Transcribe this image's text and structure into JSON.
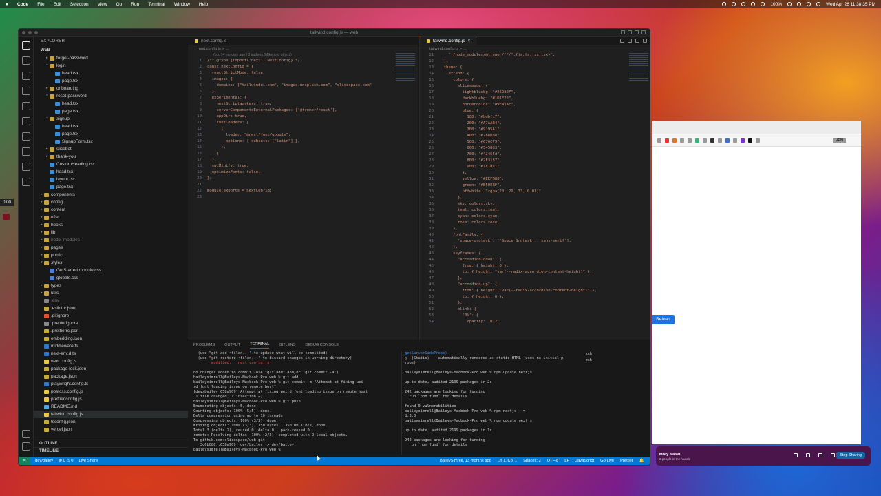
{
  "menubar": {
    "app": "Code",
    "items": [
      "File",
      "Edit",
      "Selection",
      "View",
      "Go",
      "Run",
      "Terminal",
      "Window",
      "Help"
    ],
    "battery": "100%",
    "datetime": "Wed Apr 26  11:38:35 PM"
  },
  "side_counter": "0:00",
  "window": {
    "title": "tailwind.config.js — web"
  },
  "explorer": {
    "header": "EXPLORER",
    "workspace": "WEB",
    "items": [
      {
        "label": "forgot-password",
        "indent": 1,
        "type": "folder",
        "open": false
      },
      {
        "label": "login",
        "indent": 1,
        "type": "folder",
        "open": true
      },
      {
        "label": "head.tsx",
        "indent": 2,
        "type": "tsx"
      },
      {
        "label": "page.tsx",
        "indent": 2,
        "type": "tsx"
      },
      {
        "label": "onboarding",
        "indent": 1,
        "type": "folder",
        "open": false
      },
      {
        "label": "reset-password",
        "indent": 1,
        "type": "folder",
        "open": true
      },
      {
        "label": "head.tsx",
        "indent": 2,
        "type": "tsx"
      },
      {
        "label": "page.tsx",
        "indent": 2,
        "type": "tsx"
      },
      {
        "label": "signup",
        "indent": 1,
        "type": "folder",
        "open": true
      },
      {
        "label": "head.tsx",
        "indent": 2,
        "type": "tsx"
      },
      {
        "label": "page.tsx",
        "indent": 2,
        "type": "tsx"
      },
      {
        "label": "SignupForm.tsx",
        "indent": 2,
        "type": "tsx"
      },
      {
        "label": "slicebot",
        "indent": 1,
        "type": "folder",
        "open": false
      },
      {
        "label": "thank-you",
        "indent": 1,
        "type": "folder",
        "open": false
      },
      {
        "label": "CustomHeading.tsx",
        "indent": 1,
        "type": "tsx"
      },
      {
        "label": "head.tsx",
        "indent": 1,
        "type": "tsx"
      },
      {
        "label": "layout.tsx",
        "indent": 1,
        "type": "tsx"
      },
      {
        "label": "page.tsx",
        "indent": 1,
        "type": "tsx"
      },
      {
        "label": "components",
        "indent": 0,
        "type": "folder",
        "open": false
      },
      {
        "label": "config",
        "indent": 0,
        "type": "folder",
        "open": false
      },
      {
        "label": "content",
        "indent": 0,
        "type": "folder",
        "open": false
      },
      {
        "label": "e2e",
        "indent": 0,
        "type": "folder",
        "open": false
      },
      {
        "label": "hooks",
        "indent": 0,
        "type": "folder",
        "open": false
      },
      {
        "label": "lib",
        "indent": 0,
        "type": "folder",
        "open": false
      },
      {
        "label": "node_modules",
        "indent": 0,
        "type": "folder",
        "open": false,
        "dim": true
      },
      {
        "label": "pages",
        "indent": 0,
        "type": "folder",
        "open": false
      },
      {
        "label": "public",
        "indent": 0,
        "type": "folder",
        "open": false
      },
      {
        "label": "styles",
        "indent": 0,
        "type": "folder",
        "open": true
      },
      {
        "label": "GetStarted.module.css",
        "indent": 1,
        "type": "css"
      },
      {
        "label": "globals.css",
        "indent": 1,
        "type": "css"
      },
      {
        "label": "types",
        "indent": 0,
        "type": "folder",
        "open": false
      },
      {
        "label": "utils",
        "indent": 0,
        "type": "folder",
        "open": false
      },
      {
        "label": ".env",
        "indent": 0,
        "type": "misc",
        "dim": true
      },
      {
        "label": ".eslintrc.json",
        "indent": 0,
        "type": "json"
      },
      {
        "label": ".gitignore",
        "indent": 0,
        "type": "git"
      },
      {
        "label": ".prettierignore",
        "indent": 0,
        "type": "misc"
      },
      {
        "label": ".prettierrc.json",
        "indent": 0,
        "type": "json"
      },
      {
        "label": "embedding.json",
        "indent": 0,
        "type": "json"
      },
      {
        "label": "middleware.ts",
        "indent": 0,
        "type": "ts"
      },
      {
        "label": "next-env.d.ts",
        "indent": 0,
        "type": "ts"
      },
      {
        "label": "next.config.js",
        "indent": 0,
        "type": "js"
      },
      {
        "label": "package-lock.json",
        "indent": 0,
        "type": "json"
      },
      {
        "label": "package.json",
        "indent": 0,
        "type": "json"
      },
      {
        "label": "playwright.config.ts",
        "indent": 0,
        "type": "ts"
      },
      {
        "label": "postcss.config.js",
        "indent": 0,
        "type": "js"
      },
      {
        "label": "prettier.config.js",
        "indent": 0,
        "type": "js"
      },
      {
        "label": "README.md",
        "indent": 0,
        "type": "md"
      },
      {
        "label": "tailwind.config.js",
        "indent": 0,
        "type": "js",
        "selected": true
      },
      {
        "label": "tsconfig.json",
        "indent": 0,
        "type": "json"
      },
      {
        "label": "vercel.json",
        "indent": 0,
        "type": "json"
      }
    ],
    "outline": "OUTLINE",
    "timeline": "TIMELINE"
  },
  "editor1": {
    "tab": "next.config.js",
    "breadcrumb": "next.config.js > ...",
    "codelens": "You, 14 minutes ago | 3 authors (Mike and others)",
    "lines": [
      {
        "n": "1",
        "t": "/** @type {import('next').NextConfig} */"
      },
      {
        "n": "2",
        "t": "const nextConfig = {"
      },
      {
        "n": "3",
        "t": "  reactStrictMode: false,"
      },
      {
        "n": "4",
        "t": "  images: {"
      },
      {
        "n": "5",
        "t": "    domains: [\"tailwindui.com\", \"images.unsplash.com\", \"slicespace.com\""
      },
      {
        "n": "6",
        "t": "  },"
      },
      {
        "n": "7",
        "t": "  experimental: {"
      },
      {
        "n": "8",
        "t": "    nextScriptWorkers: true,"
      },
      {
        "n": "9",
        "t": "    serverComponentsExternalPackages: ['@tremor/react'],"
      },
      {
        "n": "10",
        "t": "    appDir: true,"
      },
      {
        "n": "11",
        "t": "    fontLoaders: ["
      },
      {
        "n": "12",
        "t": "      {"
      },
      {
        "n": "13",
        "t": "        loader: \"@next/font/google\","
      },
      {
        "n": "14",
        "t": "        options: { subsets: [\"latin\"] },"
      },
      {
        "n": "15",
        "t": "      },"
      },
      {
        "n": "16",
        "t": "    ],"
      },
      {
        "n": "17",
        "t": "  },"
      },
      {
        "n": "18",
        "t": "  swcMinify: true,"
      },
      {
        "n": "19",
        "t": "  optimizeFonts: false,"
      },
      {
        "n": "20",
        "t": "};"
      },
      {
        "n": "21",
        "t": ""
      },
      {
        "n": "22",
        "t": "module.exports = nextConfig;"
      },
      {
        "n": "23",
        "t": ""
      }
    ]
  },
  "editor2": {
    "tab": "tailwind.config.js",
    "breadcrumb": "tailwind.config.js > ...",
    "lines": [
      {
        "n": "11",
        "t": "    \"./node_modules/@tremor/**/*.{js,ts,jsx,tsx}\","
      },
      {
        "n": "12",
        "t": "  ],"
      },
      {
        "n": "13",
        "t": "  theme: {"
      },
      {
        "n": "14",
        "t": "    extend: {"
      },
      {
        "n": "15",
        "t": "      colors: {"
      },
      {
        "n": "16",
        "t": "        slicespace: {"
      },
      {
        "n": "17",
        "t": "          lightbluebg: \"#26282F\","
      },
      {
        "n": "18",
        "t": "          darkbluebg: \"#1D1E22\","
      },
      {
        "n": "19",
        "t": "          bordercolor: \"#9EA1AE\","
      },
      {
        "n": "20",
        "t": "          blue: {"
      },
      {
        "n": "21",
        "t": "            100: \"#bdbfc7\","
      },
      {
        "n": "22",
        "t": "            200: \"#A7AAB4\","
      },
      {
        "n": "23",
        "t": "            300: \"#9195A1\","
      },
      {
        "n": "24",
        "t": "            400: \"#7b808e\","
      },
      {
        "n": "25",
        "t": "            500: \"#676C79\","
      },
      {
        "n": "26",
        "t": "            600: \"#545863\","
      },
      {
        "n": "27",
        "t": "            700: \"#42454d\","
      },
      {
        "n": "28",
        "t": "            800: \"#2F3137\","
      },
      {
        "n": "29",
        "t": "            900: \"#1c1d21\","
      },
      {
        "n": "30",
        "t": "          },"
      },
      {
        "n": "31",
        "t": "          yellow: \"#EEFB88\","
      },
      {
        "n": "32",
        "t": "          green: \"#B5OEBF\","
      },
      {
        "n": "33",
        "t": "          offwhite: \"rgba(28, 29, 33, 0.03)\""
      },
      {
        "n": "34",
        "t": "        },"
      },
      {
        "n": "35",
        "t": "        sky: colors.sky,"
      },
      {
        "n": "36",
        "t": "        teal: colors.teal,"
      },
      {
        "n": "37",
        "t": "        cyan: colors.cyan,"
      },
      {
        "n": "38",
        "t": "        rose: colors.rose,"
      },
      {
        "n": "39",
        "t": "      },"
      },
      {
        "n": "40",
        "t": "      fontFamily: {"
      },
      {
        "n": "41",
        "t": "        'space-grotesk': ['Space Grotesk', 'sans-serif'],"
      },
      {
        "n": "42",
        "t": "      },"
      },
      {
        "n": "43",
        "t": "      keyframes: {"
      },
      {
        "n": "44",
        "t": "        \"accordion-down\": {"
      },
      {
        "n": "45",
        "t": "          from: { height: 0 },"
      },
      {
        "n": "46",
        "t": "          to: { height: \"var(--radix-accordion-content-height)\" },"
      },
      {
        "n": "47",
        "t": "        },"
      },
      {
        "n": "48",
        "t": "        \"accordion-up\": {"
      },
      {
        "n": "49",
        "t": "          from: { height: \"var(--radix-accordion-content-height)\" },"
      },
      {
        "n": "50",
        "t": "          to: { height: 0 },"
      },
      {
        "n": "51",
        "t": "        },"
      },
      {
        "n": "52",
        "t": "        blink: {"
      },
      {
        "n": "53",
        "t": "          '0%': {"
      },
      {
        "n": "54",
        "t": "            opacity: '0.2',"
      }
    ]
  },
  "panel": {
    "tabs": [
      "PROBLEMS",
      "OUTPUT",
      "TERMINAL",
      "GITLENS",
      "DEBUG CONSOLE"
    ],
    "active_tab": "TERMINAL",
    "term1": [
      "  (use \"git add <file>...\" to update what will be committed)",
      "  (use \"git restore <file>...\" to discard changes in working directory)",
      "        modified:   next.config.js",
      "",
      "no changes added to commit (use \"git add\" and/or \"git commit -a\")",
      "baileysimrell@Baileys-Macbook-Pro web % git add .",
      "baileysimrell@Baileys-Macbook-Pro web % git commit -m \"Attempt at fixing wei",
      "rd font loading issue on remote host\"",
      "[dev/bailey 658a909] Attempt at fixing weird font loading issue on remote host",
      " 1 file changed, 1 insertion(+)",
      "baileysimrell@Baileys-Macbook-Pro web % git push",
      "Enumerating objects: 5, done.",
      "Counting objects: 100% (5/5), done.",
      "Delta compression using up to 10 threads",
      "Compressing objects: 100% (3/3), done.",
      "Writing objects: 100% (3/3), 350 bytes | 350.00 KiB/s, done.",
      "Total 3 (delta 2), reused 0 (delta 0), pack-reused 0",
      "remote: Resolving deltas: 100% (2/2), completed with 2 local objects.",
      "To github.com:slicespace/web.git",
      "   3c6b088..658a909  dev/bailey -> dev/bailey",
      "baileysimrell@Baileys-Macbook-Pro web % "
    ],
    "term2": [
      "getServerSideProps)",
      "○  (Static)    automatically rendered as static HTML (uses no initial p",
      "rops)",
      "",
      "baileysimrell@Baileys-Macbook-Pro web % npm update nextjs",
      "",
      "up to date, audited 2199 packages in 2s",
      "",
      "242 packages are looking for funding",
      "  run `npm fund` for details",
      "",
      "found 0 vulnerabilities",
      "baileysimrell@Baileys-Macbook-Pro web % npm nextjs --v",
      "8.3.0",
      "baileysimrell@Baileys-Macbook-Pro web % npm update nextjs",
      "",
      "up to date, audited 2199 packages in 1s",
      "",
      "242 packages are looking for funding",
      "  run `npm fund` for details"
    ],
    "terminals": [
      "zsh",
      "zsh"
    ]
  },
  "statusbar": {
    "branch": "dev/bailey",
    "problems": "⊗ 0 ⚠ 0",
    "live_share": "Live Share",
    "blame": "BaileySimrell, 13 months ago",
    "position": "Ln 1, Col 1",
    "spaces": "Spaces: 2",
    "encoding": "UTF-8",
    "eol": "LF",
    "language": "JavaScript",
    "golive": "Go Live",
    "prettier": "Prettier"
  },
  "browser": {
    "vpn": "VPN",
    "reload": "Reload"
  },
  "huddle": {
    "name": "Mory Katan",
    "sub": "2 people in the huddle",
    "stop": "Stop Sharing"
  }
}
